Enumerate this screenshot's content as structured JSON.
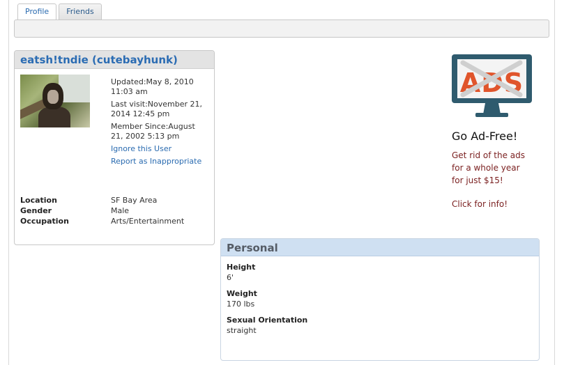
{
  "tabs": [
    {
      "label": "Profile",
      "active": true
    },
    {
      "label": "Friends",
      "active": false
    }
  ],
  "profile": {
    "title": "eatsh!tndie (cutebayhunk)",
    "updated": "Updated:May 8, 2010 11:03 am",
    "last_visit": "Last visit:November 21, 2014 12:45 pm",
    "member_since": "Member Since:August 21, 2002 5:13 pm",
    "ignore_label": "Ignore this User",
    "report_label": "Report as Inappropriate",
    "details": [
      {
        "label": "Location",
        "value": "SF Bay Area"
      },
      {
        "label": "Gender",
        "value": "Male"
      },
      {
        "label": "Occupation",
        "value": "Arts/Entertainment"
      }
    ]
  },
  "ad": {
    "logo_text": "ADS",
    "title": "Go Ad-Free!",
    "line1": "Get rid of the ads",
    "line2": "for a whole year",
    "line3": "for just $15!",
    "cta": "Click for info!",
    "colors": {
      "monitor": "#2f5b6e",
      "logo": "#e0552c",
      "text": "#7a1f1f"
    }
  },
  "personal": {
    "title": "Personal",
    "fields": [
      {
        "label": "Height",
        "value": "6'"
      },
      {
        "label": "Weight",
        "value": "170 lbs"
      },
      {
        "label": "Sexual Orientation",
        "value": "straight"
      }
    ]
  }
}
